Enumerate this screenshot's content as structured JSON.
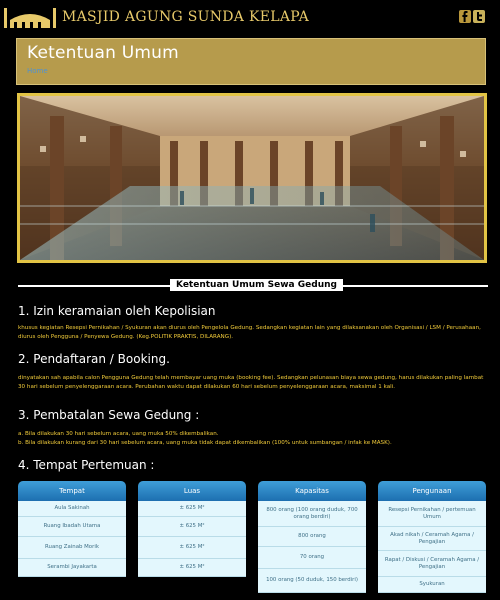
{
  "site": {
    "title": "MASJID AGUNG SUNDA KELAPA"
  },
  "social": {
    "icons": [
      "facebook-icon",
      "twitter-icon"
    ]
  },
  "header": {
    "title": "Ketentuan Umum",
    "breadcrumb": "Home"
  },
  "section": {
    "label": "Ketentuan Umum Sewa Gedung"
  },
  "rules": [
    {
      "title": "1. Izin keramaian oleh Kepolisian",
      "lines": [
        "khusus kegiatan Resepsi Pernikahan / Syukuran akan diurus oleh Pengelola Gedung. Sedangkan kegiatan lain yang dilaksanakan oleh Organisasi / LSM / Perusahaan, diurus oleh Pengguna / Penyewa Gedung. (Keg.POLITIK PRAKTIS, DILARANG)."
      ]
    },
    {
      "title": "2. Pendaftaran / Booking.",
      "lines": [
        "dinyatakan sah apabila calon Pengguna Gedung telah membayar uang muka (booking fee). Sedangkan pelunasan biaya sewa gedung, harus dilakukan paling lambat 30 hari sebelum penyelenggaraan acara. Perubahan waktu dapat dilakukan 60 hari sebelum penyelenggaraan acara, maksimal 1 kali."
      ]
    },
    {
      "title": "3. Pembatalan Sewa Gedung :",
      "lines": [
        "a. Bila dilakukan 30 hari sebelum acara, uang muka 50% dikembalikan.",
        "b. Bila dilakukan kurang dari 30 hari sebelum acara, uang muka tidak dapat dikembalikan (100% untuk sumbangan / infak ke MASK)."
      ]
    },
    {
      "title": "4. Tempat Pertemuan :",
      "lines": []
    }
  ],
  "table": {
    "columns": [
      {
        "header": "Tempat",
        "cells": [
          "Aula Sakinah",
          "Ruang Ibadah Utama",
          "Ruang Zainab Morik",
          "Serambi Jayakarta"
        ]
      },
      {
        "header": "Luas",
        "cells": [
          "± 625 M²",
          "± 625 M²",
          "± 625 M²",
          "± 625 M²"
        ]
      },
      {
        "header": "Kapasitas",
        "cells": [
          "800 orang (100 orang duduk, 700 orang berdiri)",
          "800 orang",
          "70 orang",
          "100 orang (50 duduk, 150 berdiri)"
        ]
      },
      {
        "header": "Pengunaan",
        "cells": [
          "Resepsi Pernikahan / pertemuan Umum",
          "Akad nikah / Ceramah Agama / Pengajian",
          "Rapat / Diskusi / Ceramah Agama / Pengajian",
          "Syukuran"
        ]
      }
    ]
  }
}
